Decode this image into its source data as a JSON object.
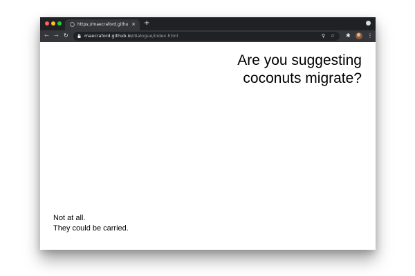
{
  "browser": {
    "tab": {
      "title": "https://maecraford.github.io/di",
      "close_glyph": "×",
      "favicon": "globe-icon"
    },
    "new_tab_glyph": "+",
    "address_bar": {
      "host": "maecraford.github.io",
      "path": "/dialogue/index.html"
    },
    "icons": {
      "back": "←",
      "forward": "→",
      "reload": "↻",
      "zoom": "⚲",
      "bookmark": "☆",
      "extensions": "✱",
      "menu": "⋮"
    }
  },
  "dialogue": {
    "question_lines": [
      "Are you suggesting",
      "coconuts migrate?"
    ],
    "answer_lines": [
      "Not at all.",
      "They could be carried."
    ]
  },
  "colors": {
    "titlebar": "#202124",
    "toolbar": "#35363a",
    "page_background": "#ffffff",
    "text": "#000000"
  }
}
